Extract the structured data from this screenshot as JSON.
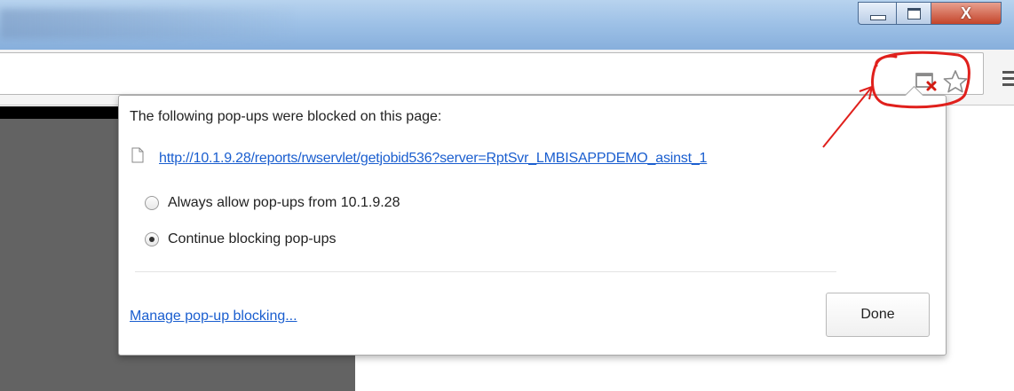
{
  "window": {
    "minimize_icon": "minimize-icon",
    "maximize_icon": "maximize-icon",
    "close_glyph": "X"
  },
  "toolbar": {
    "popup_blocked_icon": "popup-blocked-icon",
    "bookmark_icon": "star-icon",
    "menu_icon": "menu-icon"
  },
  "popup_bubble": {
    "title": "The following pop-ups were blocked on this page:",
    "blocked_popup_url": "http://10.1.9.28/reports/rwservlet/getjobid536?server=RptSvr_LMBISAPPDEMO_asinst_1",
    "options": [
      {
        "label": "Always allow pop-ups from 10.1.9.28",
        "checked": false
      },
      {
        "label": "Continue blocking pop-ups",
        "checked": true
      }
    ],
    "manage_link": "Manage pop-up blocking...",
    "done_label": "Done"
  },
  "colors": {
    "link": "#1a5ecf",
    "annotation": "#e0201c",
    "titlebar": "#9fc2e7",
    "close_button": "#c4442a"
  }
}
